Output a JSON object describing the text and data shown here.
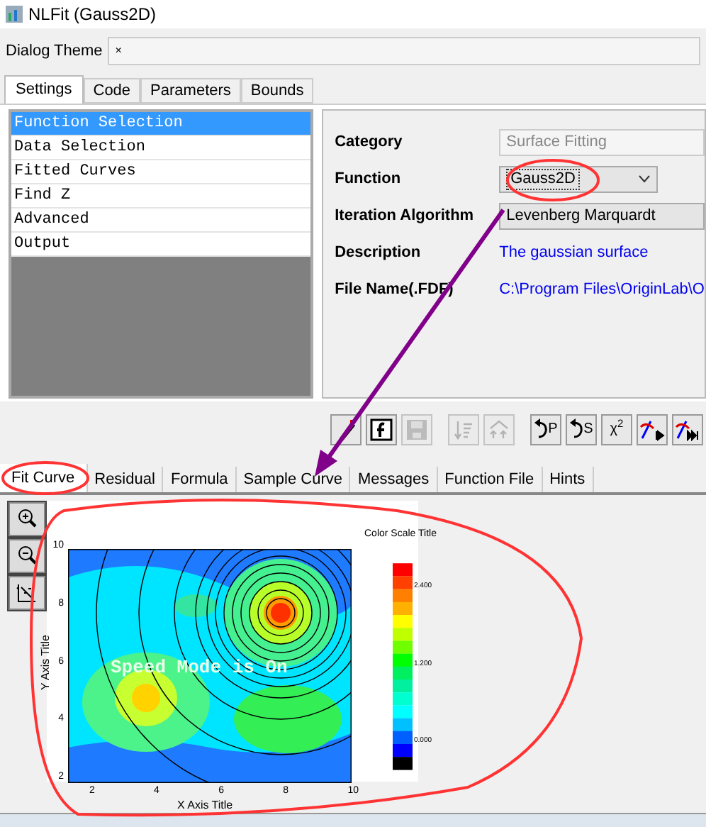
{
  "window": {
    "title": "NLFit (Gauss2D)"
  },
  "dialog_theme": {
    "label": "Dialog Theme",
    "value": "×"
  },
  "tabs": [
    {
      "label": "Settings",
      "selected": true
    },
    {
      "label": "Code",
      "selected": false
    },
    {
      "label": "Parameters",
      "selected": false
    },
    {
      "label": "Bounds",
      "selected": false
    }
  ],
  "tree": [
    {
      "label": "Function Selection",
      "selected": true
    },
    {
      "label": "Data Selection",
      "selected": false
    },
    {
      "label": "Fitted Curves",
      "selected": false
    },
    {
      "label": "Find Z",
      "selected": false
    },
    {
      "label": "Advanced",
      "selected": false
    },
    {
      "label": "Output",
      "selected": false
    }
  ],
  "settings": [
    {
      "kind": "disabled-field",
      "label": "Category",
      "value": "Surface Fitting"
    },
    {
      "kind": "dropdown",
      "label": "Function",
      "value": "Gauss2D"
    },
    {
      "kind": "field",
      "label": "Iteration Algorithm",
      "value": "Levenberg Marquardt"
    },
    {
      "kind": "link",
      "label": "Description",
      "value": "The gaussian surface"
    },
    {
      "kind": "link",
      "label": "File Name(.FDF)",
      "value": "C:\\Program Files\\OriginLab\\O"
    }
  ],
  "toolbar": [
    {
      "kind": "edit-function",
      "disabled": false
    },
    {
      "kind": "function-box",
      "disabled": false
    },
    {
      "kind": "save",
      "disabled": true
    },
    {
      "kind": "sort-down",
      "disabled": true
    },
    {
      "kind": "sort-up",
      "disabled": true
    },
    {
      "kind": "undo",
      "label": "P",
      "disabled": false
    },
    {
      "kind": "undo",
      "label": "S",
      "disabled": false
    },
    {
      "kind": "chi",
      "label": "χ$^{2}$",
      "disabled": false
    },
    {
      "kind": "step",
      "disabled": false
    },
    {
      "kind": "fast",
      "disabled": false
    }
  ],
  "bottom_tabs": [
    {
      "label": "Fit Curve",
      "selected": true
    },
    {
      "label": "Residual",
      "selected": false
    },
    {
      "label": "Formula",
      "selected": false
    },
    {
      "label": "Sample Curve",
      "selected": false
    },
    {
      "label": "Messages",
      "selected": false
    },
    {
      "label": "Function File",
      "selected": false
    },
    {
      "label": "Hints",
      "selected": false
    }
  ],
  "plot": {
    "overlay": "Speed Mode is On",
    "x_title": "X Axis Title",
    "y_title": "Y Axis Title",
    "color_scale_title": "Color Scale Title",
    "x_ticks": [
      "2",
      "4",
      "6",
      "8",
      "10"
    ],
    "y_ticks": [
      "10",
      "8",
      "6",
      "4",
      "2"
    ],
    "scale_ticks": [
      "2.400",
      "1.200",
      "0.000"
    ]
  }
}
